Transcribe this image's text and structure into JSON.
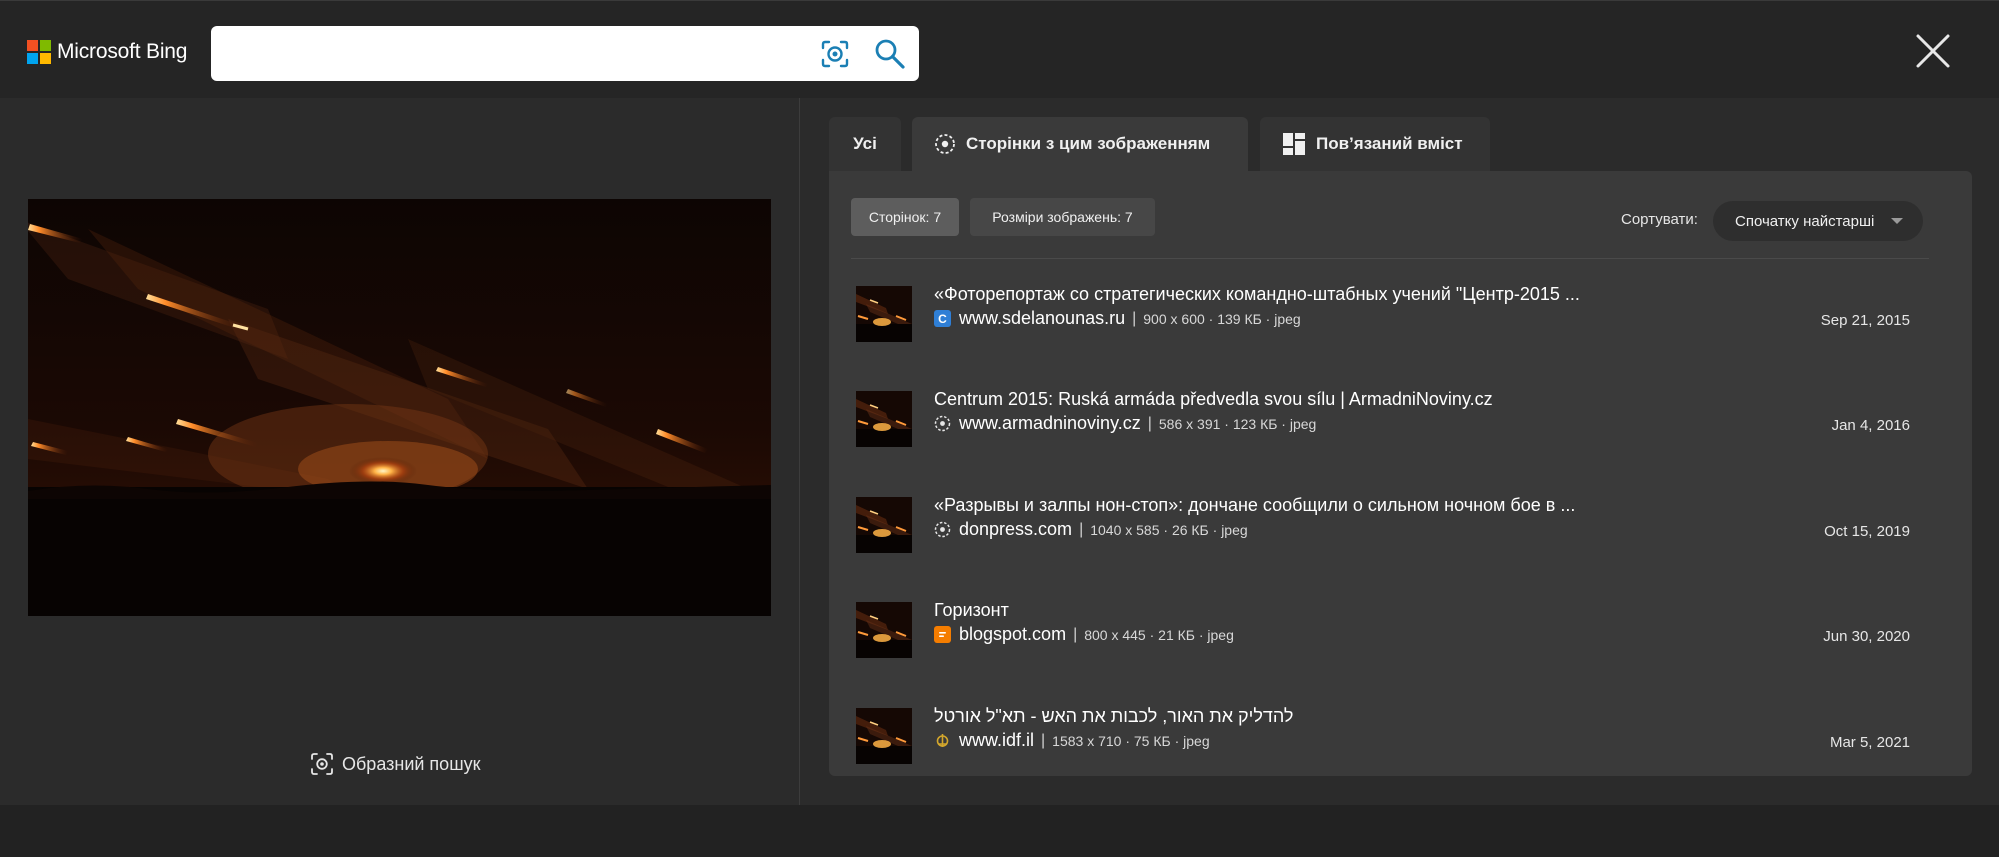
{
  "header": {
    "brand": "Microsoft Bing",
    "search_value": "",
    "colors": {
      "ms_red": "#f25022",
      "ms_green": "#7fba00",
      "ms_blue": "#00a4ef",
      "ms_yellow": "#ffb900",
      "accent": "#1a73a8"
    }
  },
  "left_pane": {
    "visual_search_label": "Образний пошук"
  },
  "tabs": [
    {
      "label": "Усі",
      "icon": "none",
      "selected": false
    },
    {
      "label": "Сторінки з цим зображенням",
      "icon": "globe-icon",
      "selected": true
    },
    {
      "label": "Пов’язаний вміст",
      "icon": "grid-icon",
      "selected": false
    }
  ],
  "filters": {
    "pages_chip": "Сторінок: 7",
    "sizes_chip": "Розміри зображень: 7",
    "sort_label": "Сортувати:",
    "sort_value": "Спочатку найстарші"
  },
  "results": [
    {
      "title": "«Фоторепортаж со стратегических командно-штабных учений \"Центр-2015 ...",
      "favicon": "letter-c-icon",
      "domain": "www.sdelanounas.ru",
      "sep": "|",
      "meta": "900 x 600 · 139 КБ · jpeg",
      "date": "Sep 21, 2015"
    },
    {
      "title": "Centrum 2015: Ruská armáda předvedla svou sílu | ArmadniNoviny.cz",
      "favicon": "globe-icon",
      "domain": "www.armadninoviny.cz",
      "sep": "|",
      "meta": "586 x 391 · 123 КБ · jpeg",
      "date": "Jan 4, 2016"
    },
    {
      "title": "«Разрывы и залпы нон-стоп»: дончане сообщили о сильном ночном бое в ...",
      "favicon": "globe-icon",
      "domain": "donpress.com",
      "sep": "|",
      "meta": "1040 x 585 · 26 КБ · jpeg",
      "date": "Oct 15, 2019"
    },
    {
      "title": "Горизонт",
      "favicon": "blogger-icon",
      "domain": "blogspot.com",
      "sep": "|",
      "meta": "800 x 445 · 21 КБ · jpeg",
      "date": "Jun 30, 2020"
    },
    {
      "title": "להדליק את האור, לכבות את האש - תא\"ל אורטל",
      "favicon": "idf-emblem-icon",
      "domain": "www.idf.il",
      "sep": "|",
      "meta": "1583 x 710 · 75 КБ · jpeg",
      "date": "Mar 5, 2021"
    }
  ]
}
